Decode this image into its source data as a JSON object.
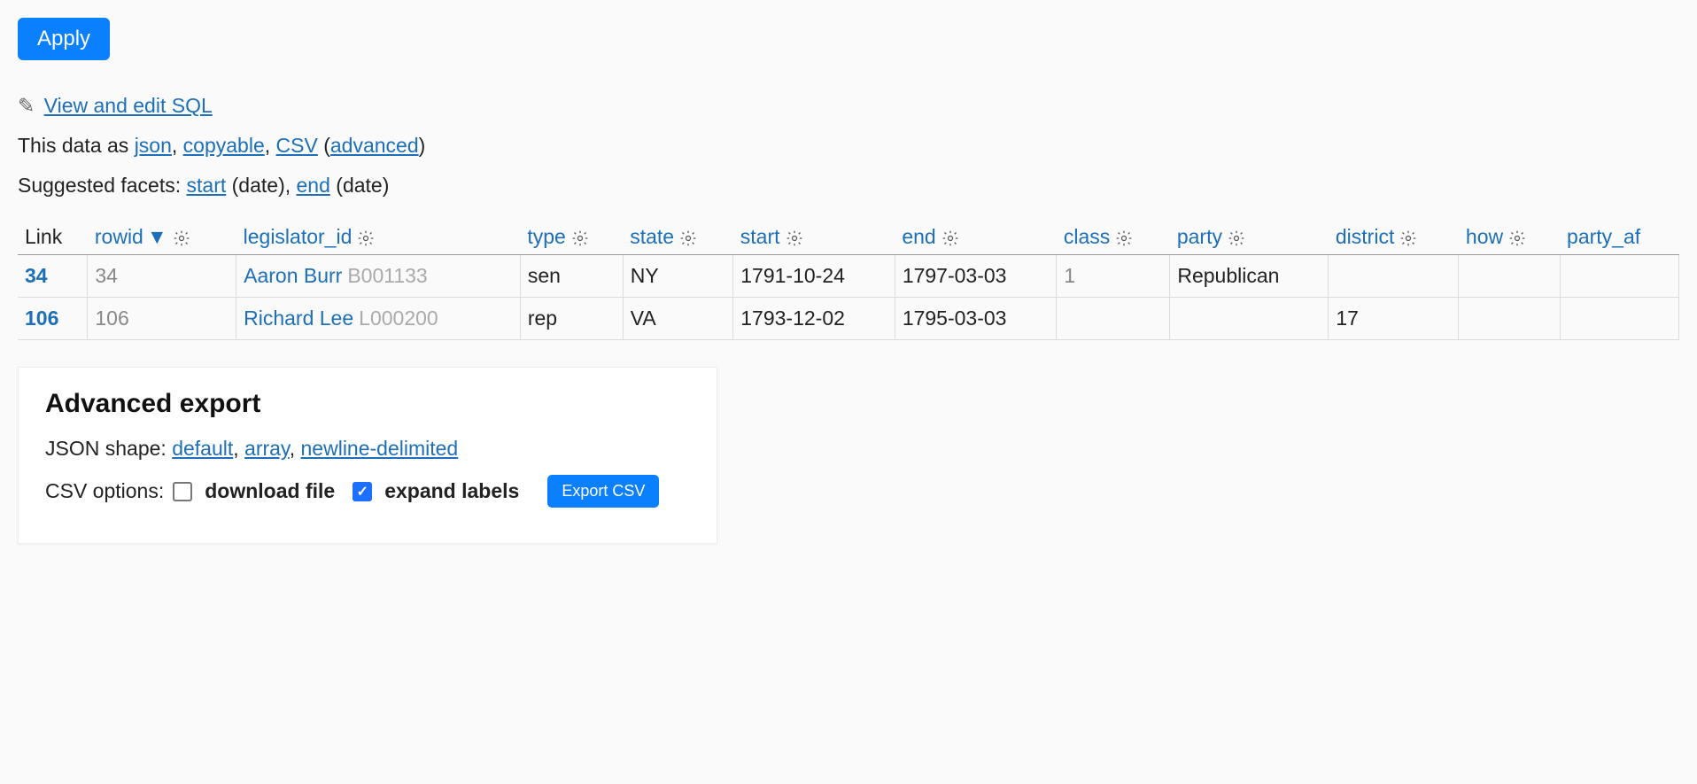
{
  "apply_label": "Apply",
  "sql_link": "View and edit SQL",
  "data_as": {
    "prefix": "This data as ",
    "json": "json",
    "copyable": "copyable",
    "csv": "CSV",
    "advanced": "advanced"
  },
  "facets": {
    "prefix": "Suggested facets: ",
    "start": "start",
    "start_suffix": " (date), ",
    "end": "end",
    "end_suffix": " (date)"
  },
  "columns": {
    "link": "Link",
    "rowid": "rowid",
    "legislator_id": "legislator_id",
    "type": "type",
    "state": "state",
    "start": "start",
    "end": "end",
    "class": "class",
    "party": "party",
    "district": "district",
    "how": "how",
    "party_af": "party_af"
  },
  "rows": [
    {
      "link": "34",
      "rowid": "34",
      "leg_name": "Aaron Burr",
      "leg_id": "B001133",
      "type": "sen",
      "state": "NY",
      "start": "1791-10-24",
      "end": "1797-03-03",
      "class": "1",
      "party": "Republican",
      "district": "",
      "how": ""
    },
    {
      "link": "106",
      "rowid": "106",
      "leg_name": "Richard Lee",
      "leg_id": "L000200",
      "type": "rep",
      "state": "VA",
      "start": "1793-12-02",
      "end": "1795-03-03",
      "class": "",
      "party": "",
      "district": "17",
      "how": ""
    }
  ],
  "export": {
    "title": "Advanced export",
    "json_shape_prefix": "JSON shape: ",
    "default": "default",
    "array": "array",
    "newline": "newline-delimited",
    "csv_options_prefix": "CSV options:",
    "download_file": "download file",
    "expand_labels": "expand labels",
    "export_csv": "Export CSV"
  }
}
